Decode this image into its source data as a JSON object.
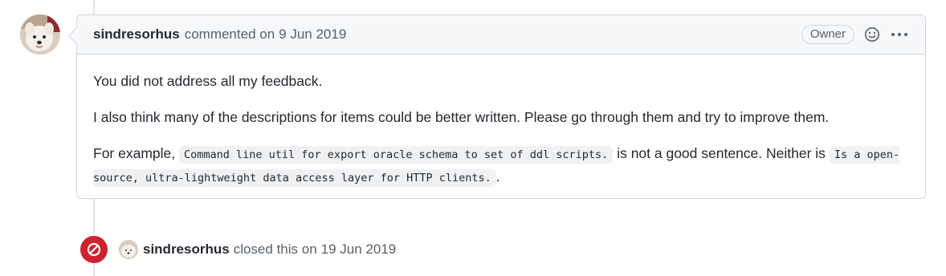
{
  "comment": {
    "author": "sindresorhus",
    "action": "commented on",
    "date": "9 Jun 2019",
    "badge": "Owner",
    "icons": {
      "reaction": "smiley-icon",
      "menu": "kebab-menu-icon",
      "avatar": "samoyed-dog-avatar"
    },
    "body": {
      "p1": "You did not address all my feedback.",
      "p2": "I also think many of the descriptions for items could be better written. Please go through them and try to improve them.",
      "p3_prefix": "For example,",
      "p3_code1": "Command line util for export oracle schema to set of ddl scripts.",
      "p3_mid": "is not a good sentence. Neither is",
      "p3_code2": "Is a open-source, ultra-lightweight data access layer for HTTP clients.",
      "p3_suffix": "."
    }
  },
  "event": {
    "icon": "closed-circle-slash-icon",
    "actor": "sindresorhus",
    "action": "closed this on",
    "date": "19 Jun 2019",
    "color": "#cf222e"
  }
}
